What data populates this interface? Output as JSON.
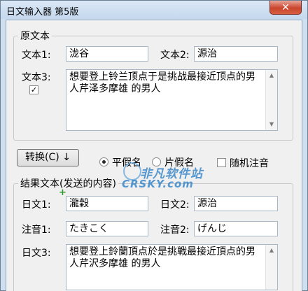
{
  "window": {
    "title": "日文输入器 第5版",
    "close_glyph": "✕"
  },
  "source": {
    "legend": "原文本",
    "text1_label": "文本1:",
    "text1_value": "泷谷",
    "text2_label": "文本2:",
    "text2_value": "源治",
    "text3_label": "文本3:",
    "text3_value": "想要登上铃兰顶点于是挑战最接近顶点的男人芹泽多摩雄 的男人",
    "text3_checked": "✓"
  },
  "controls": {
    "convert_label": "转换(C) ↓",
    "hiragana_label": "平假名",
    "hiragana_selected": true,
    "katakana_label": "片假名",
    "random_label": "随机注音"
  },
  "result": {
    "legend": "结果文本(发送的内容)",
    "jp1_label": "日文1:",
    "jp1_value": "瀧穀",
    "jp2_label": "日文2:",
    "jp2_value": "源治",
    "note1_label": "注音1:",
    "note1_value": "たきこく",
    "note2_label": "注音2:",
    "note2_value": "げんじ",
    "jp3_label": "日文3:",
    "jp3_value": "想要登上鈴蘭頂点於是挑戦最接近頂点的男人芹沢多摩雄 的男人",
    "plus_glyph": "+"
  },
  "watermark": {
    "line1": "非凡软件站",
    "line2": "CRSKY.com"
  },
  "icons": {
    "scroll_up": "▲",
    "scroll_down": "▼"
  },
  "colors": {
    "titlebar": "#c5d8ee",
    "close_button": "#c9452d",
    "plus_marker": "#2d9a2d",
    "watermark": "#3b88c9"
  }
}
